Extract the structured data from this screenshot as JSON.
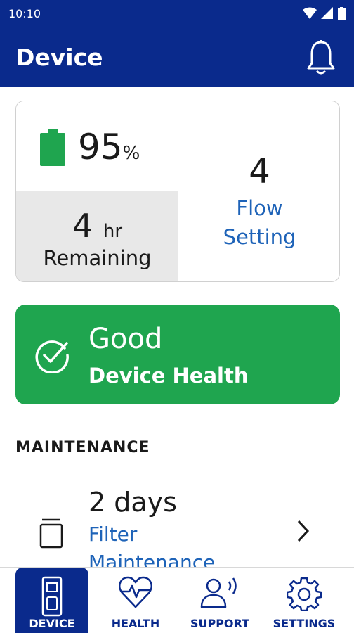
{
  "status_bar": {
    "time": "10:10"
  },
  "app_bar": {
    "title": "Device"
  },
  "battery": {
    "percent": "95",
    "unit": "%",
    "color": "#1fa54f"
  },
  "remaining": {
    "value": "4",
    "unit": "hr",
    "label": "Remaining"
  },
  "flow": {
    "value": "4",
    "label_line1": "Flow",
    "label_line2": "Setting"
  },
  "health": {
    "status": "Good",
    "label": "Device Health",
    "color": "#1fa54f"
  },
  "maintenance": {
    "heading": "MAINTENANCE",
    "items": [
      {
        "value": "2 days",
        "label_line1": "Filter",
        "label_line2": "Maintenance",
        "icon": "filter-icon"
      }
    ]
  },
  "nav": {
    "items": [
      {
        "label": "DEVICE",
        "icon": "device-icon",
        "active": true
      },
      {
        "label": "HEALTH",
        "icon": "heart-pulse-icon",
        "active": false
      },
      {
        "label": "SUPPORT",
        "icon": "support-person-icon",
        "active": false
      },
      {
        "label": "SETTINGS",
        "icon": "gear-icon",
        "active": false
      }
    ]
  },
  "colors": {
    "primary": "#0a2a8c",
    "link": "#1e63b8",
    "success": "#1fa54f"
  }
}
